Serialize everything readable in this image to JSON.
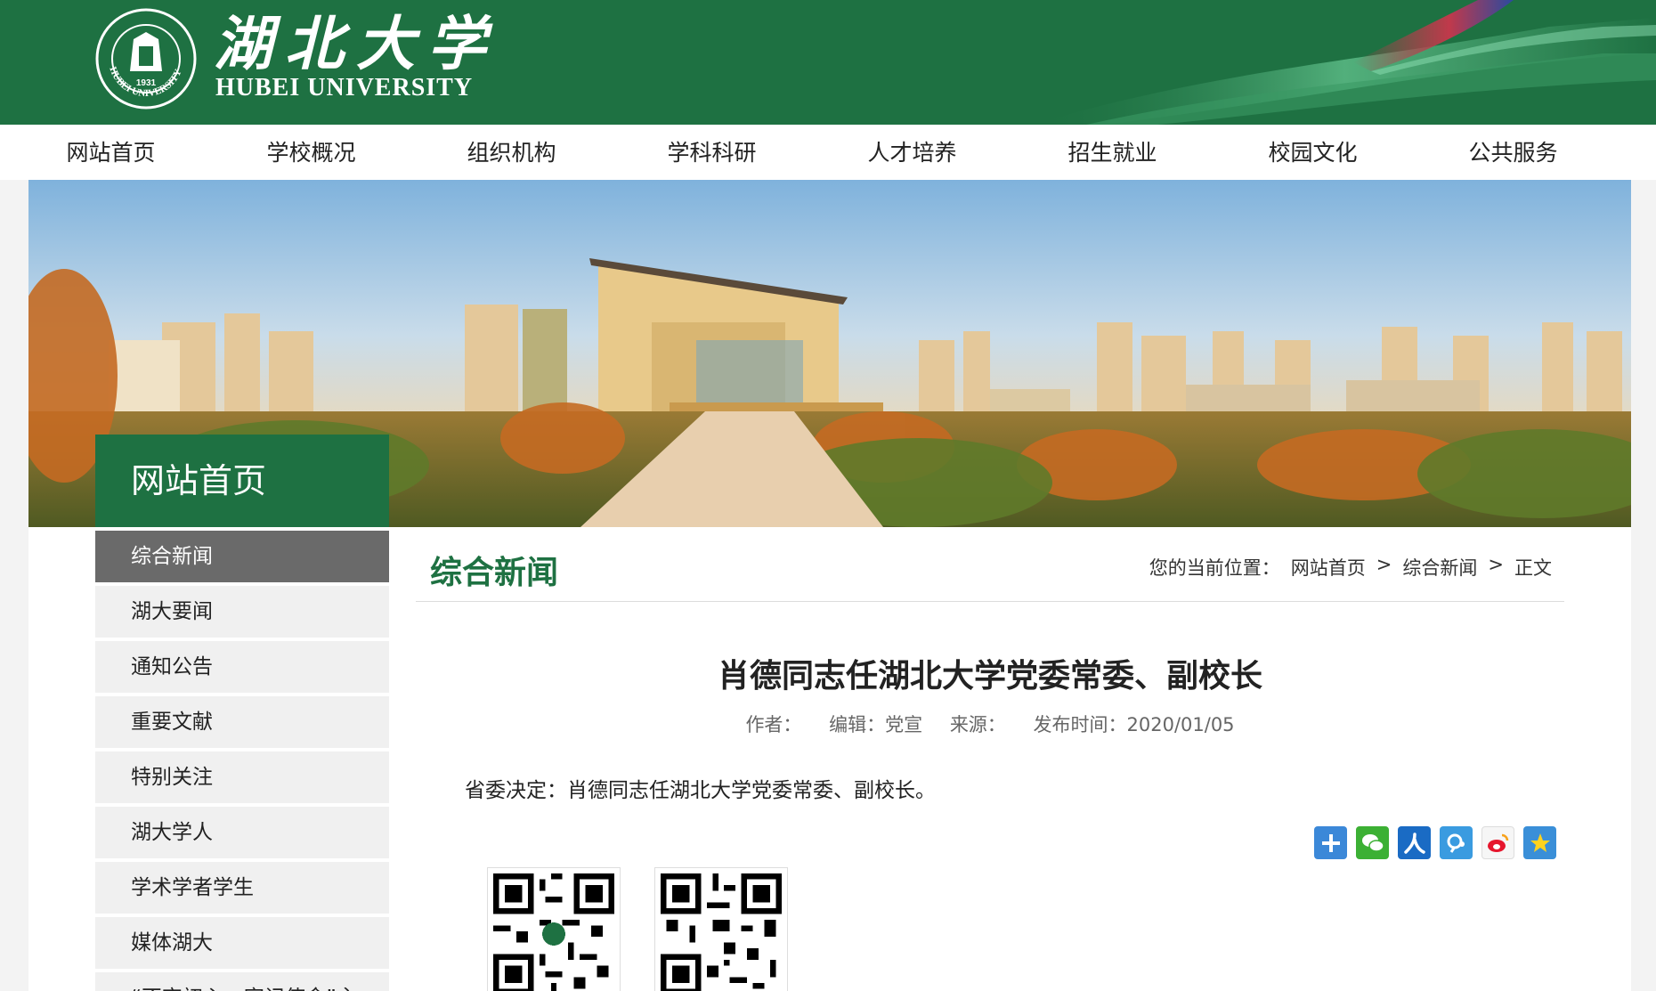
{
  "header": {
    "logo_cn": "湖北大学",
    "logo_en": "HUBEI UNIVERSITY",
    "seal_year": "1931"
  },
  "nav": [
    "网站首页",
    "学校概况",
    "组织机构",
    "学科科研",
    "人才培养",
    "招生就业",
    "校园文化",
    "公共服务"
  ],
  "sidebar": {
    "title": "网站首页",
    "items": [
      "综合新闻",
      "湖大要闻",
      "通知公告",
      "重要文献",
      "特别关注",
      "湖大学人",
      "学术学者学生",
      "媒体湖大",
      "“不忘初心、牢记使命”主"
    ]
  },
  "content": {
    "section_title": "综合新闻",
    "breadcrumb": {
      "label": "您的当前位置：",
      "items": [
        "网站首页",
        "综合新闻",
        "正文"
      ],
      "separator": ">"
    },
    "article": {
      "title": "肖德同志任湖北大学党委常委、副校长",
      "author": "作者：",
      "editor": "编辑：党宣",
      "source": "来源：",
      "date": "发布时间：2020/01/05",
      "body": "省委决定：肖德同志任湖北大学党委常委、副校长。"
    }
  },
  "share_icons": [
    "plus-icon",
    "wechat-icon",
    "renren-icon",
    "tencent-weibo-icon",
    "sina-weibo-icon",
    "favorite-star-icon"
  ],
  "colors": {
    "brand_green": "#1e7142",
    "active_gray": "#6a6a6a"
  }
}
